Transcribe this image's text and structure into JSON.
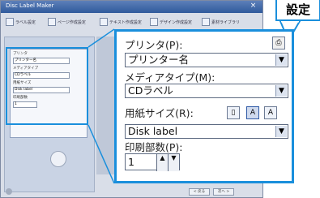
{
  "window": {
    "title": "Disc Label Maker",
    "close_glyph": "×"
  },
  "toolbar": {
    "buttons": [
      "ラベル設定",
      "ページ作成設定",
      "テキスト作成設定",
      "デザイン作成設定",
      "素材ライブラリ"
    ]
  },
  "small_panel": {
    "rows": [
      "プリンタ",
      "プリンター名",
      "メディアタイプ",
      "CDラベル",
      "用紙サイズ",
      "Disk label",
      "印刷部数"
    ],
    "copies": "1"
  },
  "footer": {
    "buttons": [
      "< 戻る",
      "次へ >"
    ]
  },
  "callout": {
    "label": "設定"
  },
  "zoom": {
    "printer_label": "プリンタ(P):",
    "printer_value": "プリンター名",
    "media_label": "メディアタイプ(M):",
    "media_value": "CDラベル",
    "paper_label": "用紙サイズ(R):",
    "paper_value": "Disk label",
    "copies_label": "印刷部数(P):",
    "copies_value": "1",
    "dropdown_glyph": "▼",
    "spin_up": "▲",
    "spin_down": "▼"
  }
}
